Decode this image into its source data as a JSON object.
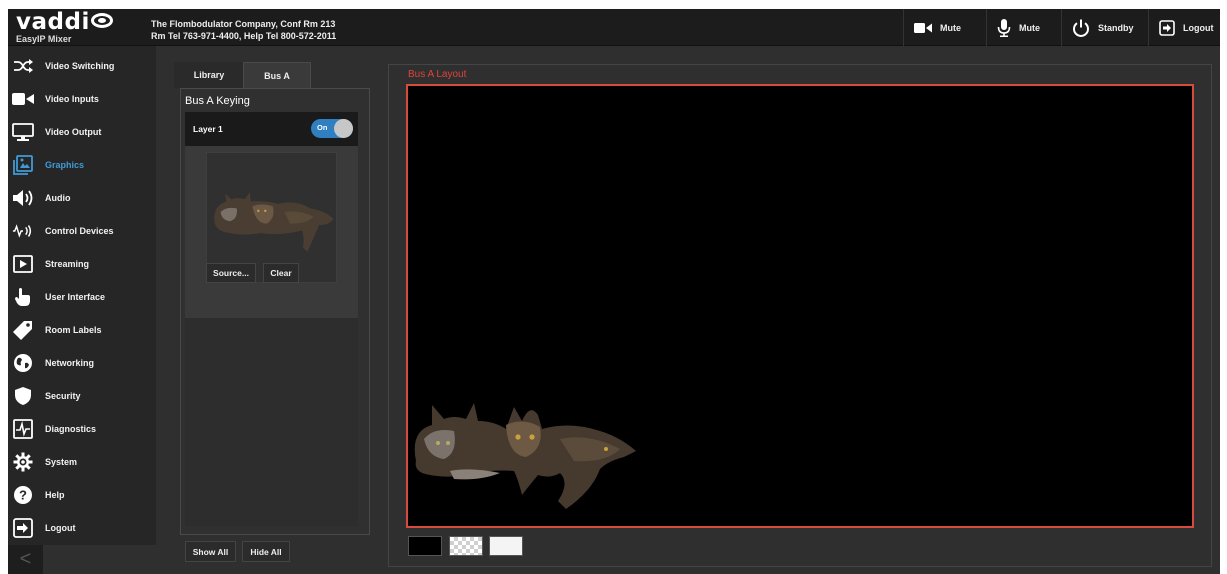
{
  "header": {
    "logo_word": "vaddi",
    "product": "EasyIP Mixer",
    "company_line": "The Flombodulator Company, Conf Rm 213",
    "phone_line": "Rm Tel 763-971-4400, Help Tel 800-572-2011",
    "buttons": [
      {
        "label": "Mute",
        "icon": "video-camera-icon"
      },
      {
        "label": "Mute",
        "icon": "microphone-icon"
      },
      {
        "label": "Standby",
        "icon": "power-icon"
      },
      {
        "label": "Logout",
        "icon": "logout-icon"
      }
    ]
  },
  "sidebar": {
    "items": [
      {
        "label": "Video Switching",
        "icon": "shuffle-icon"
      },
      {
        "label": "Video Inputs",
        "icon": "video-camera-icon"
      },
      {
        "label": "Video Output",
        "icon": "monitor-icon"
      },
      {
        "label": "Graphics",
        "icon": "graphics-icon",
        "active": true
      },
      {
        "label": "Audio",
        "icon": "speaker-icon"
      },
      {
        "label": "Control Devices",
        "icon": "control-signal-icon"
      },
      {
        "label": "Streaming",
        "icon": "play-icon"
      },
      {
        "label": "User Interface",
        "icon": "hand-pointer-icon"
      },
      {
        "label": "Room Labels",
        "icon": "tag-icon"
      },
      {
        "label": "Networking",
        "icon": "globe-icon"
      },
      {
        "label": "Security",
        "icon": "shield-icon"
      },
      {
        "label": "Diagnostics",
        "icon": "pulse-icon"
      },
      {
        "label": "System",
        "icon": "gear-icon"
      },
      {
        "label": "Help",
        "icon": "help-icon"
      },
      {
        "label": "Logout",
        "icon": "logout-icon"
      }
    ],
    "collapse_label": "<"
  },
  "tabs": {
    "library": "Library",
    "bus_a": "Bus A"
  },
  "keying": {
    "title": "Bus A Keying",
    "layer_label": "Layer 1",
    "toggle_label": "On",
    "source_label": "Source...",
    "clear_label": "Clear",
    "show_all_label": "Show All",
    "hide_all_label": "Hide All"
  },
  "layout": {
    "title": "Bus A Layout",
    "swatches": [
      "black",
      "checkerboard",
      "white"
    ]
  },
  "colors": {
    "accent": "#3f9bd8",
    "layout_border": "#d84a3c",
    "toggle_on": "#2f7fc1"
  }
}
